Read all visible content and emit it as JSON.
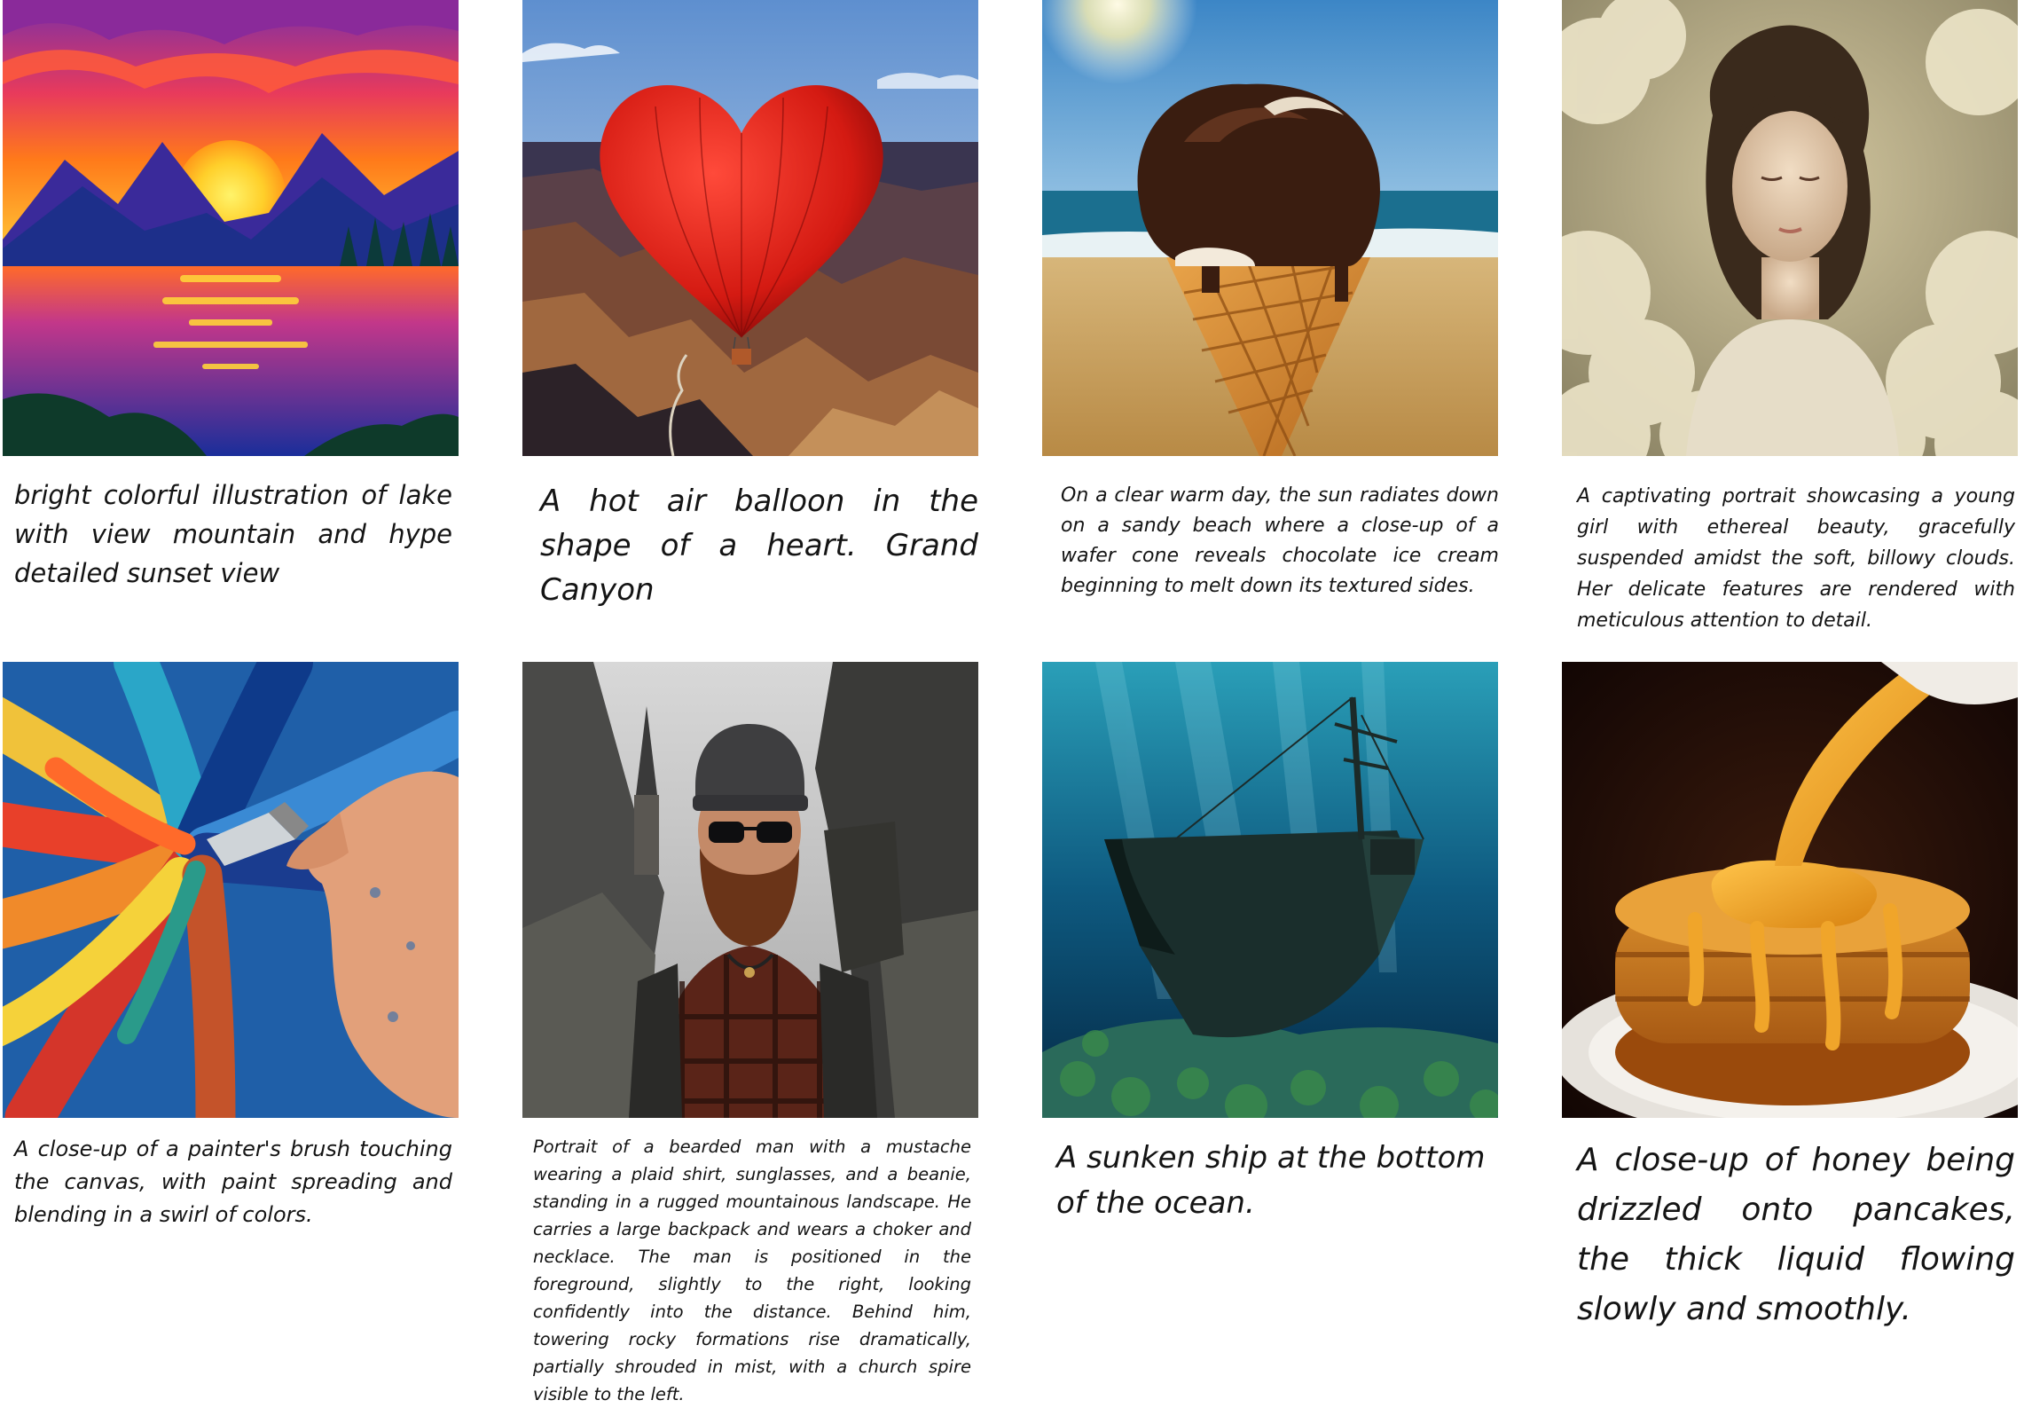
{
  "gallery": {
    "items": [
      {
        "name": "sunset-lake-illustration",
        "caption": "bright colorful illustration of lake with view mountain and hype detailed sunset view"
      },
      {
        "name": "heart-balloon-canyon",
        "caption": "A hot air balloon in the shape of a heart. Grand Canyon"
      },
      {
        "name": "ice-cream-beach",
        "caption": "On a clear warm day, the sun radiates down on a sandy beach where a close-up of a wafer cone reveals chocolate ice cream beginning to melt down its textured sides."
      },
      {
        "name": "girl-in-clouds-portrait",
        "caption": "A captivating portrait showcasing a young girl with ethereal beauty, gracefully suspended amidst the soft, billowy clouds. Her delicate features are rendered with meticulous attention to detail."
      },
      {
        "name": "painter-brush-canvas",
        "caption": "A close-up of a painter's brush touching the canvas, with paint spreading and blending in a swirl of colors."
      },
      {
        "name": "bearded-man-portrait",
        "caption": "Portrait of a bearded man with a mustache wearing a plaid shirt, sunglasses, and a beanie, standing in a rugged mountainous landscape. He carries a large backpack and wears a choker and necklace. The man is positioned in the foreground, slightly to the right, looking confidently into the distance. Behind him, towering rocky formations rise dramatically, partially shrouded in mist, with a church spire visible to the left."
      },
      {
        "name": "sunken-ship-ocean",
        "caption": "A sunken ship at the bottom of the ocean."
      },
      {
        "name": "honey-pancakes",
        "caption": "A close-up of honey being drizzled onto pancakes, the thick liquid flowing slowly and smoothly."
      }
    ]
  },
  "colors": {
    "background": "#ffffff",
    "caption_text": "#141414"
  }
}
